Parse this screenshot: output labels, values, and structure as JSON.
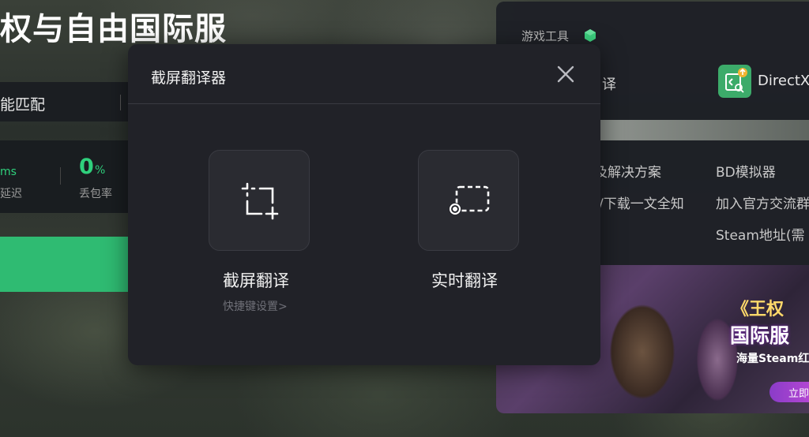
{
  "page": {
    "title": "权与自由国际服"
  },
  "left_panel": {
    "header_label": "能匹配",
    "latency_value": "ms",
    "latency_label": "延迟",
    "loss_value": "0",
    "loss_unit": "%",
    "loss_label": "丢包率"
  },
  "right_panel": {
    "section_title": "游戏工具",
    "tool_translate_label": "译",
    "tool_directx_label": "DirectX",
    "links": [
      "及解决方案",
      "BD模拟器",
      "/下载一文全知",
      "加入官方交流群",
      "Steam地址(需"
    ],
    "banner": {
      "line1": "《王权",
      "line2": "国际服",
      "line3": "海量Steam红",
      "button": "立即"
    }
  },
  "modal": {
    "title": "截屏翻译器",
    "options": [
      {
        "label": "截屏翻译",
        "sublabel": "快捷键设置>",
        "icon": "crop-icon"
      },
      {
        "label": "实时翻译",
        "sublabel": "",
        "icon": "screen-record-icon"
      }
    ]
  },
  "colors": {
    "accent_green": "#2fd07c",
    "modal_bg": "#212228",
    "card_bg": "#2a2b31"
  }
}
